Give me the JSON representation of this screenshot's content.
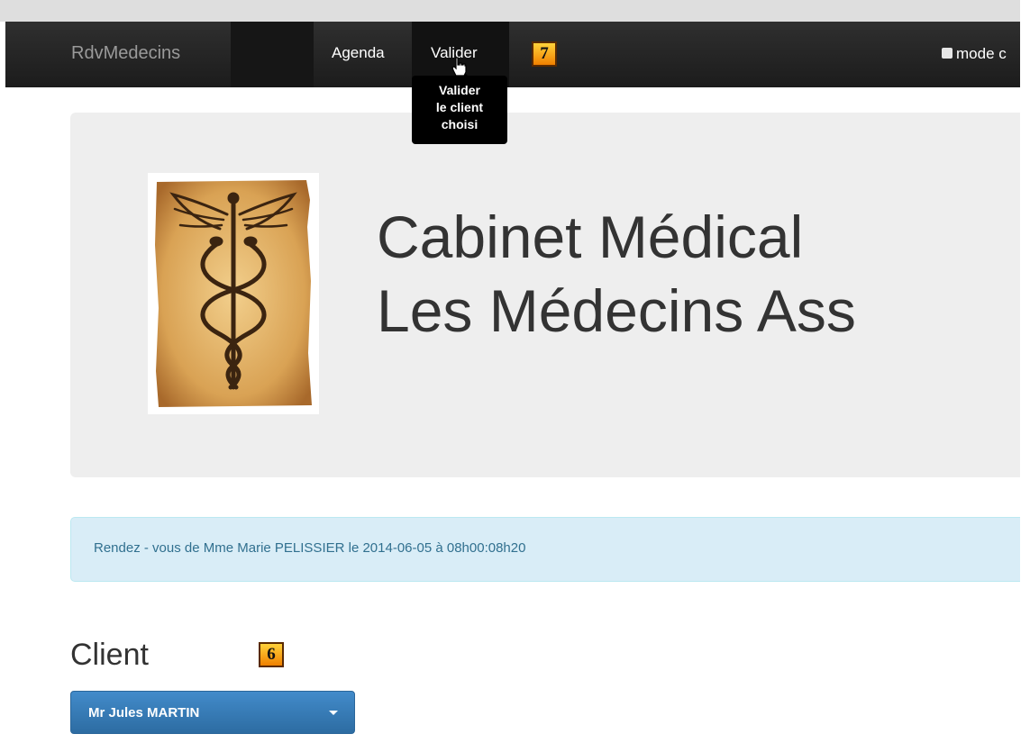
{
  "navbar": {
    "brand": "RdvMedecins",
    "items": [
      {
        "label": "Agenda"
      },
      {
        "label": "Valider"
      }
    ],
    "mode_label": "mode c"
  },
  "tooltip": {
    "text": "Valider le client choisi"
  },
  "badges": {
    "seven": "7",
    "six": "6"
  },
  "jumbotron": {
    "title_line1": "Cabinet Médical",
    "title_line2": "Les Médecins Ass"
  },
  "alert": {
    "text": "Rendez - vous de Mme Marie PELISSIER le 2014-06-05 à 08h00:08h20"
  },
  "client": {
    "heading": "Client",
    "selected": "Mr Jules MARTIN"
  },
  "colors": {
    "navbar": "#222222",
    "jumbotron": "#eeeeee",
    "alert_bg": "#d9edf7",
    "alert_text": "#31708f",
    "primary": "#428bca",
    "badge": "#f5a000"
  },
  "icons": {
    "logo": "caduceus-icon",
    "cursor": "hand-pointer-icon",
    "dropdown": "caret-down-icon",
    "checkbox": "checkbox-icon"
  }
}
